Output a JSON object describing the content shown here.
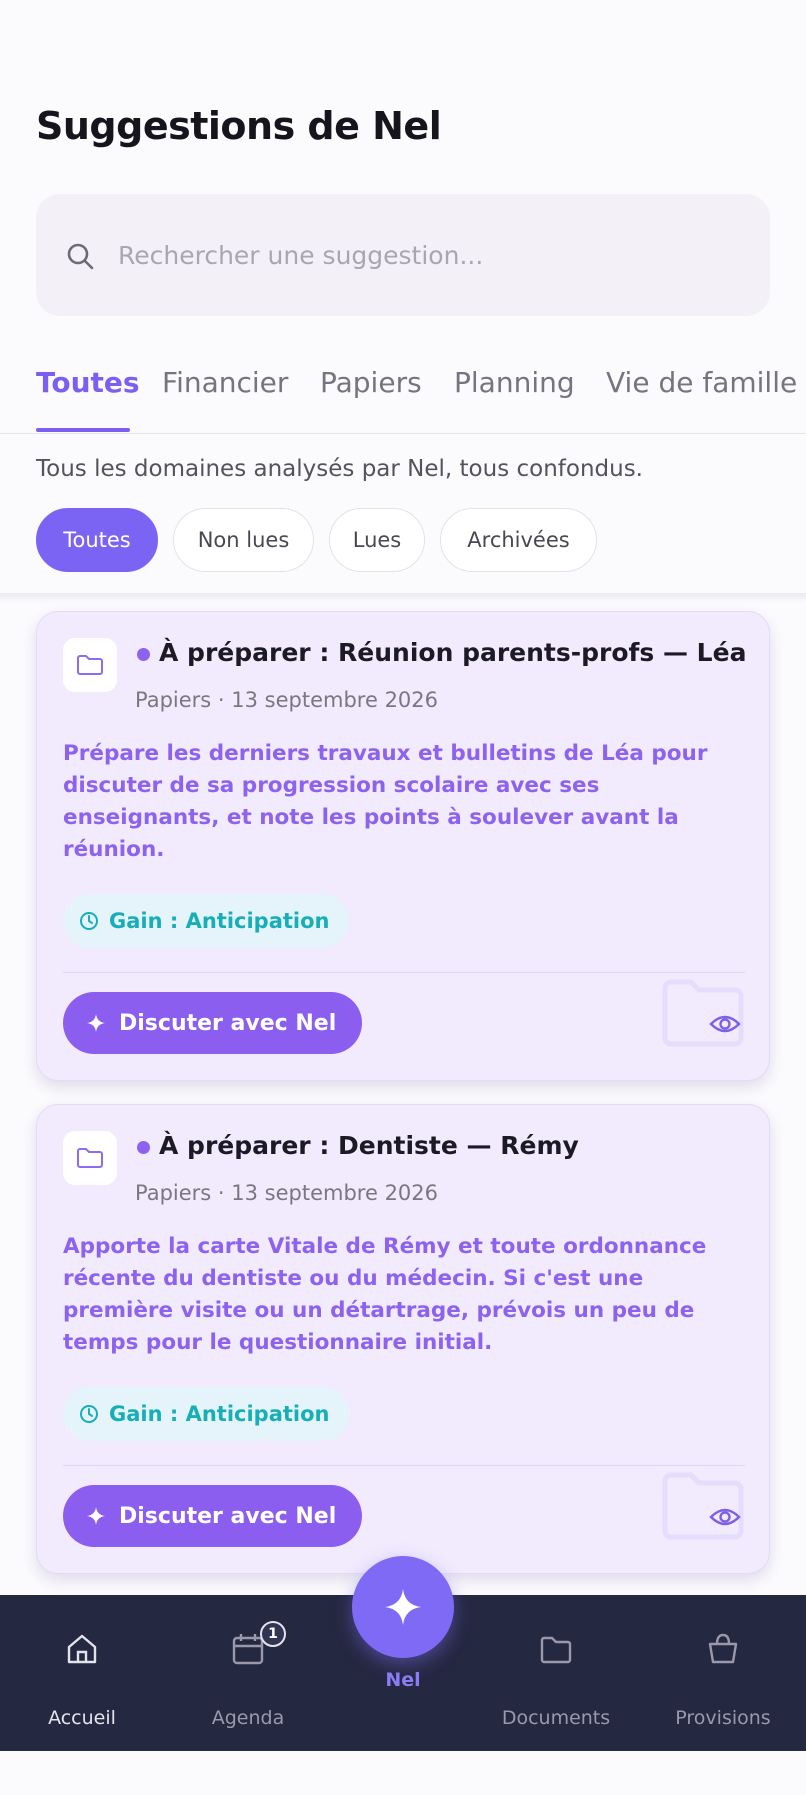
{
  "page": {
    "title": "Suggestions de Nel"
  },
  "search": {
    "placeholder": "Rechercher une suggestion..."
  },
  "tabs": [
    {
      "label": "Toutes",
      "active": true
    },
    {
      "label": "Financier",
      "active": false
    },
    {
      "label": "Papiers",
      "active": false
    },
    {
      "label": "Planning",
      "active": false
    },
    {
      "label": "Vie de famille",
      "active": false
    }
  ],
  "subtitle": "Tous les domaines analysés par Nel, tous confondus.",
  "filters": [
    {
      "label": "Toutes",
      "active": true
    },
    {
      "label": "Non lues",
      "active": false
    },
    {
      "label": "Lues",
      "active": false
    },
    {
      "label": "Archivées",
      "active": false
    }
  ],
  "cards": [
    {
      "icon": "folder-icon",
      "title": "À préparer : Réunion parents-profs — Léa",
      "meta": "Papiers · 13 septembre 2026",
      "body": "Prépare les derniers travaux et bulletins de Léa pour discuter de sa progression scolaire avec ses enseignants, et note les points à soulever avant la réunion.",
      "gain": "Gain : Anticipation",
      "action": "Discuter avec Nel"
    },
    {
      "icon": "folder-icon",
      "title": "À préparer : Dentiste — Rémy",
      "meta": "Papiers · 13 septembre 2026",
      "body": "Apporte la carte Vitale de Rémy et toute ordonnance récente du dentiste ou du médecin. Si c'est une première visite ou un détartrage, prévois un peu de temps pour le questionnaire initial.",
      "gain": "Gain : Anticipation",
      "action": "Discuter avec Nel"
    }
  ],
  "bottom_nav": {
    "items": [
      {
        "label": "Accueil",
        "icon": "home-icon"
      },
      {
        "label": "Agenda",
        "icon": "calendar-icon",
        "badge": "1"
      },
      {
        "label": "Documents",
        "icon": "folder-icon"
      },
      {
        "label": "Provisions",
        "icon": "basket-icon"
      }
    ],
    "center": {
      "label": "Nel",
      "icon": "sparkle-icon"
    }
  },
  "colors": {
    "accent": "#7b64f4",
    "card_background": "#f1ebfd",
    "body_text": "#8c62ee",
    "gain_text": "#17aeb8",
    "nav_background": "#252841"
  }
}
